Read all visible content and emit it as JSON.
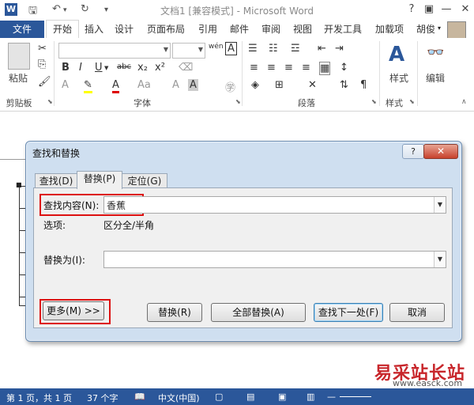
{
  "titlebar": {
    "title": "文档1 [兼容模式] - Microsoft Word",
    "help": "?",
    "minimize": "—",
    "restore": "❐",
    "close": "✕"
  },
  "tabs": {
    "file": "文件",
    "items": [
      "开始",
      "插入",
      "设计",
      "页面布局",
      "引用",
      "邮件",
      "审阅",
      "视图",
      "开发工具",
      "加载项"
    ],
    "active": "开始",
    "user": "胡俊"
  },
  "ribbon": {
    "clipboard": {
      "paste": "粘贴",
      "label": "剪贴板"
    },
    "font": {
      "label": "字体",
      "bold": "B",
      "italic": "I",
      "underline": "U",
      "strike": "abc",
      "sub": "x₂",
      "sup": "x²",
      "size_change": "Aa",
      "wen": "wén",
      "boxA": "A"
    },
    "paragraph": {
      "label": "段落"
    },
    "styles": {
      "label": "样式",
      "btn": "样式"
    },
    "editing": {
      "btn": "编辑"
    }
  },
  "dialog": {
    "title": "查找和替换",
    "help": "?",
    "close": "✕",
    "tabs": [
      {
        "label": "查找(D)"
      },
      {
        "label": "替换(P)"
      },
      {
        "label": "定位(G)"
      }
    ],
    "find_label": "查找内容(N):",
    "find_value": "香蕉",
    "options_label": "选项:",
    "options_value": "区分全/半角",
    "replace_label": "替换为(I):",
    "replace_value": "",
    "buttons": {
      "more": "更多(M) >>",
      "replace": "替换(R)",
      "replace_all": "全部替换(A)",
      "find_next": "查找下一处(F)",
      "cancel": "取消"
    }
  },
  "statusbar": {
    "page": "第 1 页，共 1 页",
    "words": "37 个字",
    "lang": "中文(中国)"
  },
  "watermark": {
    "text": "易采站长站",
    "url": "www.easck.com"
  }
}
